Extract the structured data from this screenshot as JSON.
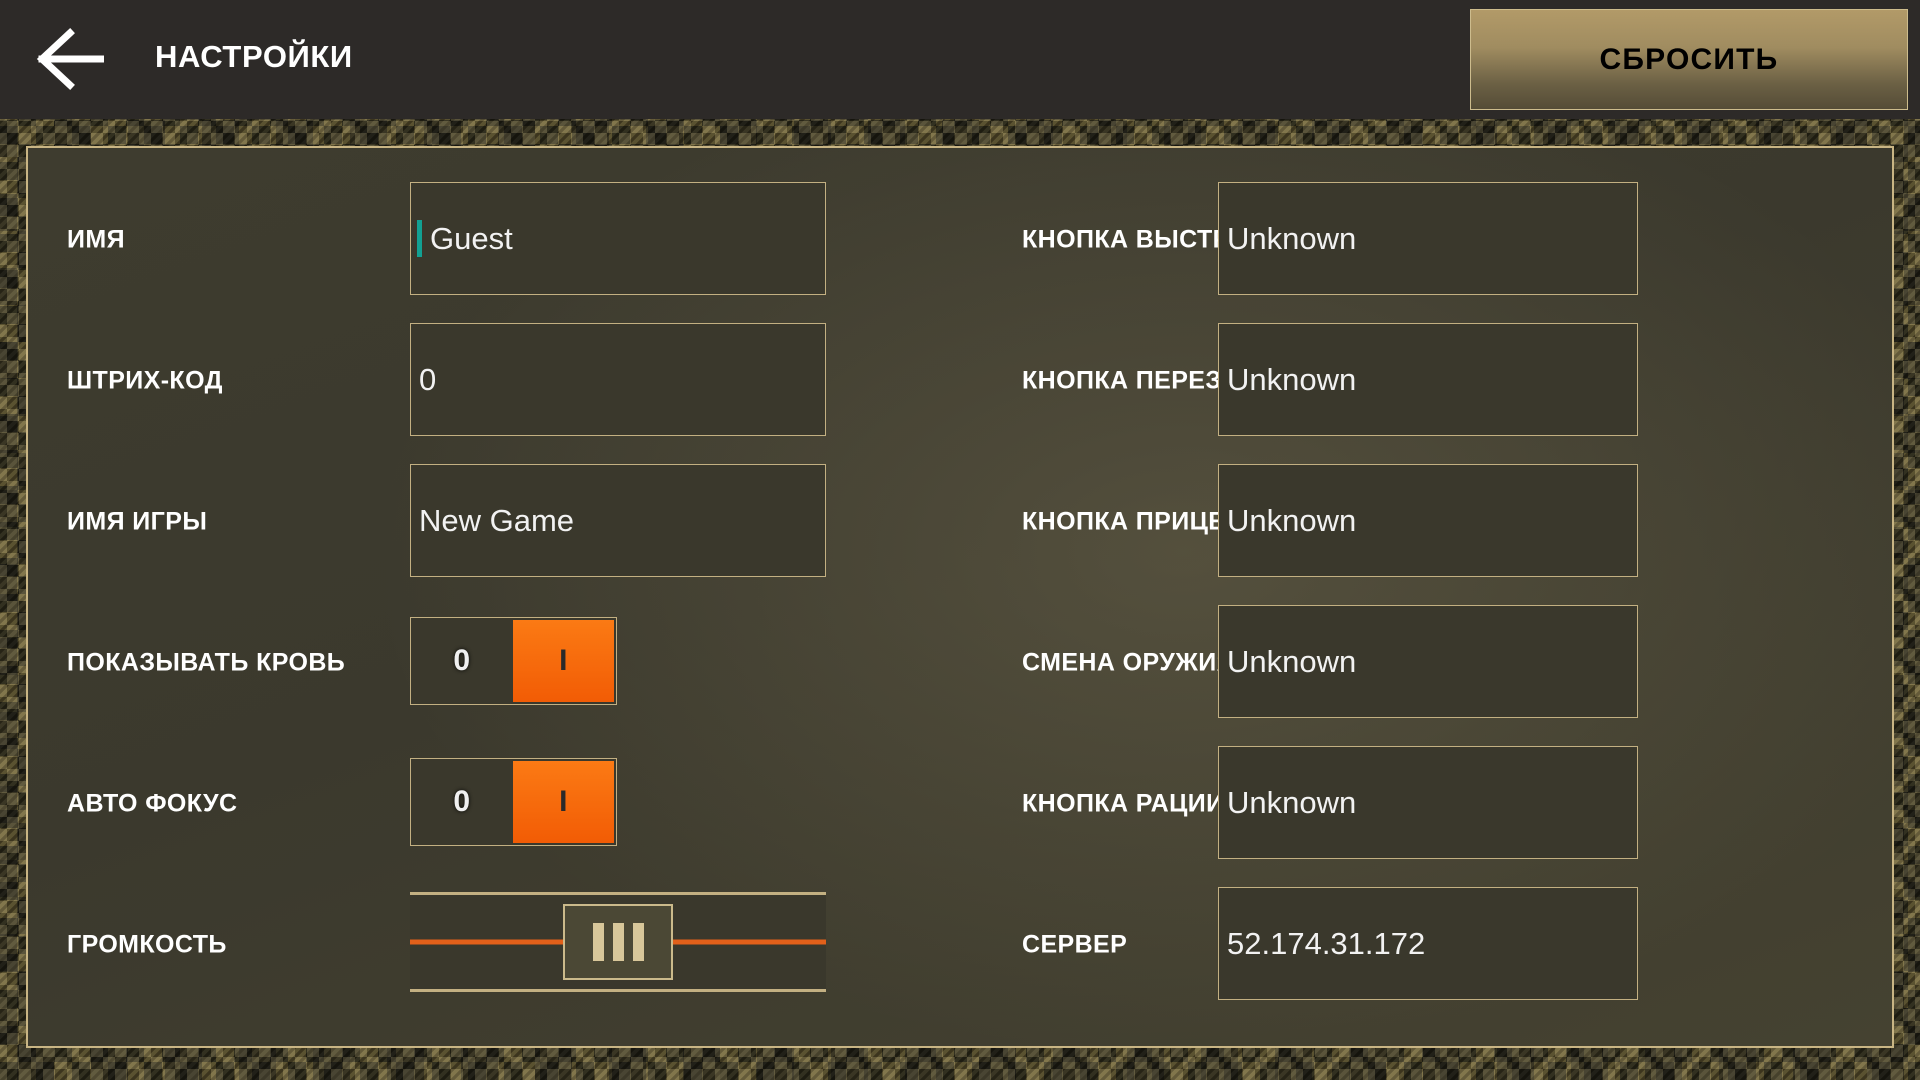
{
  "header": {
    "back_icon": "back-arrow-icon",
    "title": "НАСТРОЙКИ",
    "reset_label": "СБРОСИТЬ"
  },
  "colors": {
    "accent_orange": "#f25c05",
    "border_tan": "#c3b082",
    "panel_bg": "#3b392d",
    "header_bg": "#2d2a28",
    "caret_teal": "#12a193",
    "button_gold": "#a08c60"
  },
  "left_column": [
    {
      "label": "ИМЯ",
      "type": "text",
      "value": "Guest",
      "caret": true
    },
    {
      "label": "ШТРИХ-КОД",
      "type": "text",
      "value": "0",
      "caret": false
    },
    {
      "label": "ИМЯ ИГРЫ",
      "type": "text",
      "value": "New Game",
      "caret": false
    },
    {
      "label": "ПОКАЗЫВАТЬ КРОВЬ",
      "type": "toggle",
      "off_label": "0",
      "on_label": "I",
      "state": "on"
    },
    {
      "label": "АВТО ФОКУС",
      "type": "toggle",
      "off_label": "0",
      "on_label": "I",
      "state": "on"
    },
    {
      "label": "ГРОМКОСТЬ",
      "type": "slider",
      "value": 50
    }
  ],
  "right_column": [
    {
      "label": "КНОПКА ВЫСТРЕЛА",
      "type": "text",
      "value": "Unknown"
    },
    {
      "label": "КНОПКА ПЕРЕЗАРЯДКИ",
      "type": "text",
      "value": "Unknown"
    },
    {
      "label": "КНОПКА ПРИЦЕЛ",
      "type": "text",
      "value": "Unknown"
    },
    {
      "label": "СМЕНА ОРУЖИЯ",
      "type": "text",
      "value": "Unknown"
    },
    {
      "label": "КНОПКА РАЦИИ",
      "type": "text",
      "value": "Unknown"
    },
    {
      "label": "СЕРВЕР",
      "type": "text",
      "value": "52.174.31.172"
    }
  ]
}
